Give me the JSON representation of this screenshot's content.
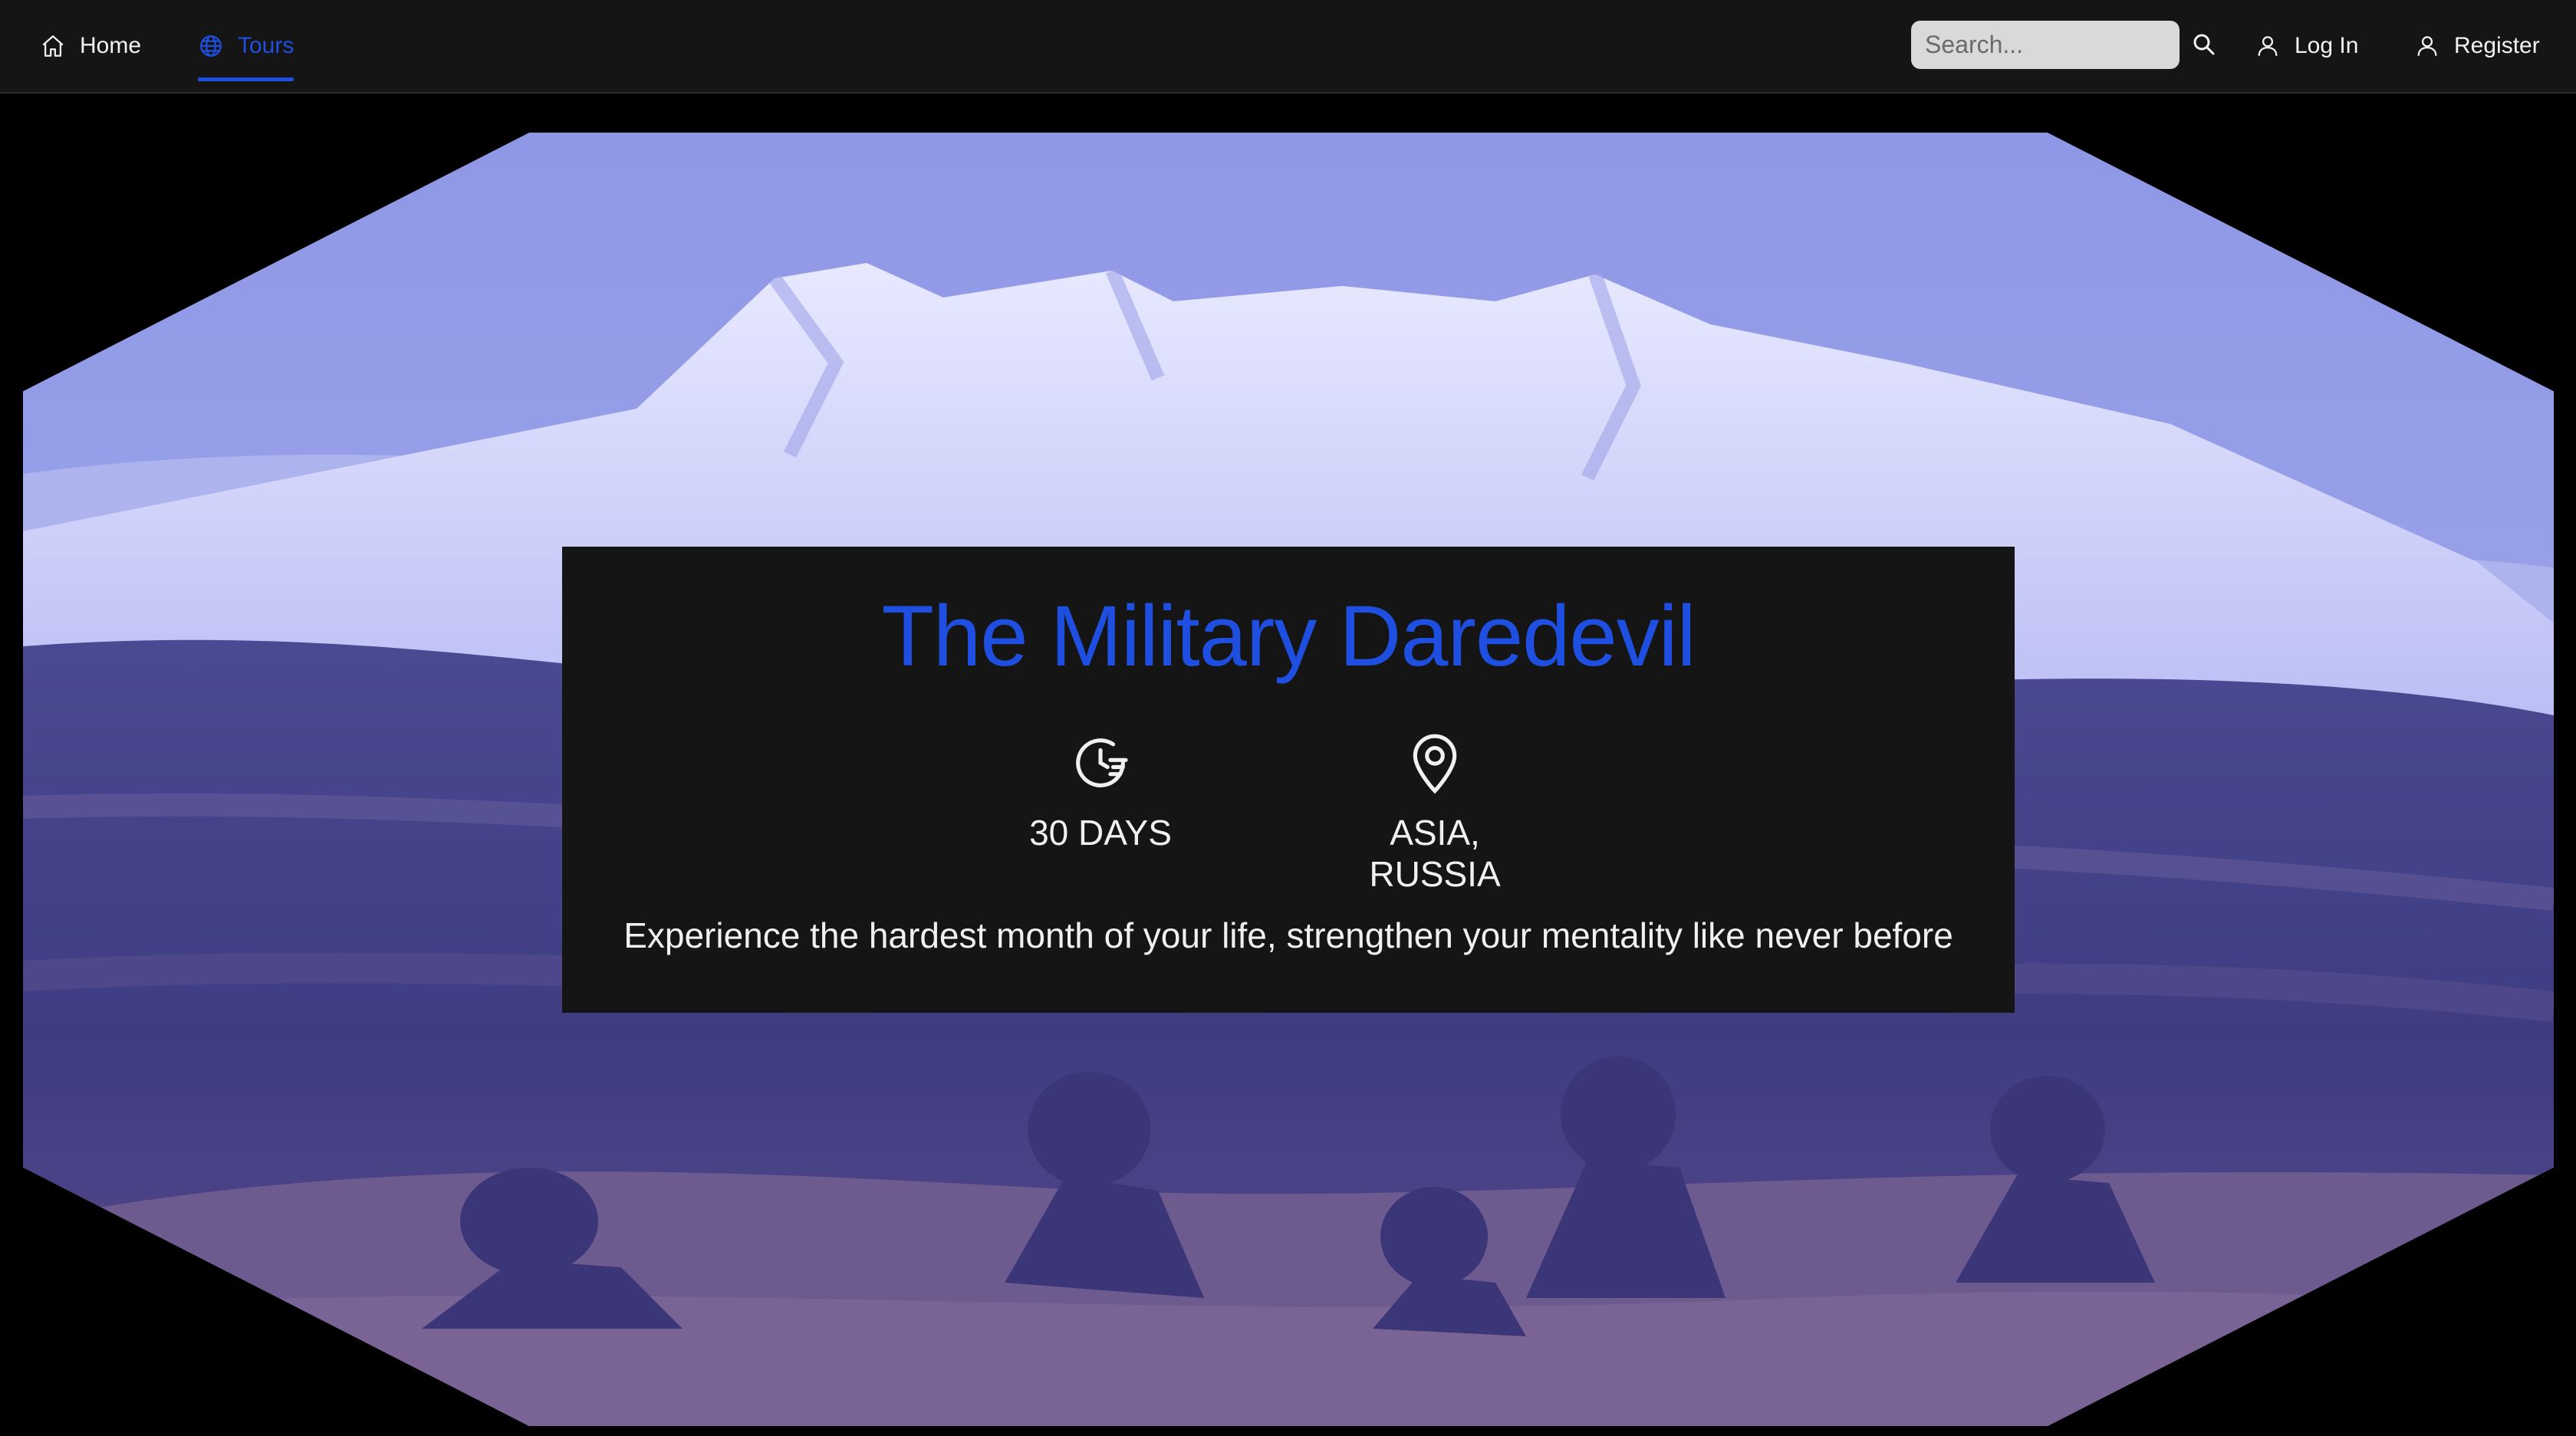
{
  "nav": {
    "home_label": "Home",
    "tours_label": "Tours",
    "search_placeholder": "Search...",
    "login_label": "Log In",
    "register_label": "Register",
    "active_color": "#1f4fe0"
  },
  "tour": {
    "title": "The Military Daredevil",
    "duration": "30 DAYS",
    "location": "ASIA, RUSSIA",
    "description": "Experience the hardest month of your life, strengthen your mentality like never before"
  },
  "icons": {
    "home": "home-icon",
    "tours": "globe-icon",
    "search": "search-icon",
    "user": "user-icon",
    "duration": "clock-icon",
    "location": "map-pin-icon"
  }
}
